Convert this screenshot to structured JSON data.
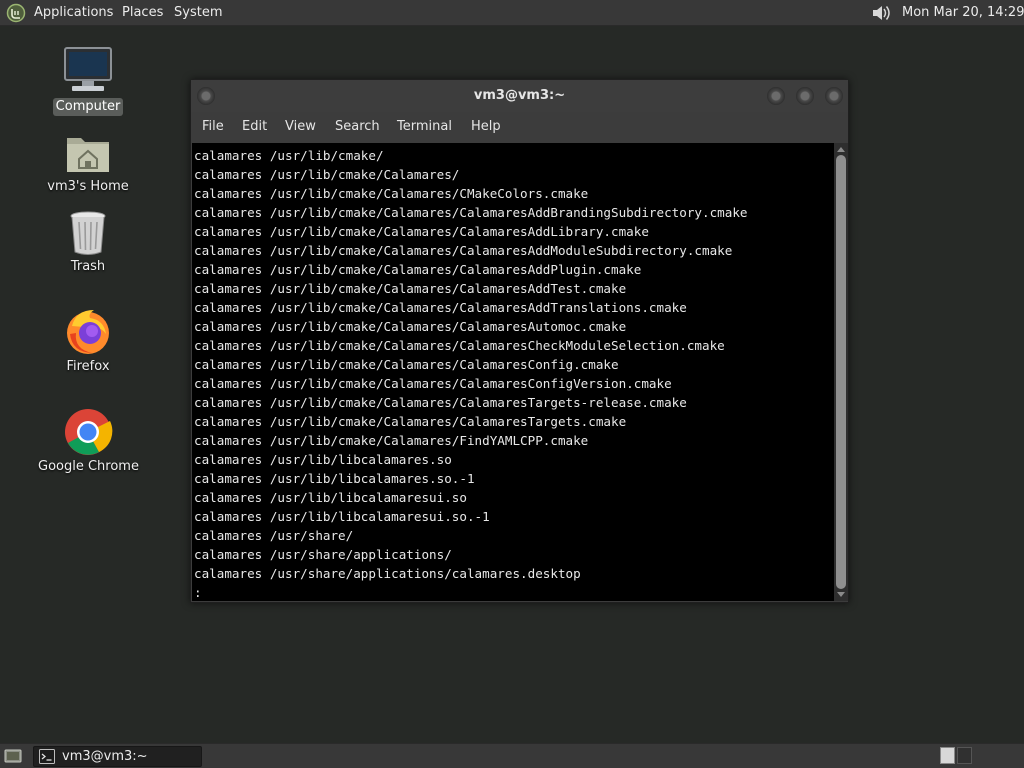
{
  "top_panel": {
    "menus": [
      "Applications",
      "Places",
      "System"
    ],
    "clock": "Mon Mar 20, 14:29",
    "icons": {
      "menu": "mint-menu-icon",
      "volume": "volume-icon"
    }
  },
  "desktop": {
    "icons": [
      {
        "label": "Computer",
        "icon": "computer-icon",
        "selected": true
      },
      {
        "label": "vm3's Home",
        "icon": "home-folder-icon",
        "selected": false
      },
      {
        "label": "Trash",
        "icon": "trash-icon",
        "selected": false
      },
      {
        "label": "Firefox",
        "icon": "firefox-icon",
        "selected": false
      },
      {
        "label": "Google Chrome",
        "icon": "chrome-icon",
        "selected": false
      }
    ]
  },
  "terminal": {
    "title": "vm3@vm3:~",
    "menu": [
      "File",
      "Edit",
      "View",
      "Search",
      "Terminal",
      "Help"
    ],
    "lines": [
      "calamares /usr/lib/cmake/",
      "calamares /usr/lib/cmake/Calamares/",
      "calamares /usr/lib/cmake/Calamares/CMakeColors.cmake",
      "calamares /usr/lib/cmake/Calamares/CalamaresAddBrandingSubdirectory.cmake",
      "calamares /usr/lib/cmake/Calamares/CalamaresAddLibrary.cmake",
      "calamares /usr/lib/cmake/Calamares/CalamaresAddModuleSubdirectory.cmake",
      "calamares /usr/lib/cmake/Calamares/CalamaresAddPlugin.cmake",
      "calamares /usr/lib/cmake/Calamares/CalamaresAddTest.cmake",
      "calamares /usr/lib/cmake/Calamares/CalamaresAddTranslations.cmake",
      "calamares /usr/lib/cmake/Calamares/CalamaresAutomoc.cmake",
      "calamares /usr/lib/cmake/Calamares/CalamaresCheckModuleSelection.cmake",
      "calamares /usr/lib/cmake/Calamares/CalamaresConfig.cmake",
      "calamares /usr/lib/cmake/Calamares/CalamaresConfigVersion.cmake",
      "calamares /usr/lib/cmake/Calamares/CalamaresTargets-release.cmake",
      "calamares /usr/lib/cmake/Calamares/CalamaresTargets.cmake",
      "calamares /usr/lib/cmake/Calamares/FindYAMLCPP.cmake",
      "calamares /usr/lib/libcalamares.so",
      "calamares /usr/lib/libcalamares.so.-1",
      "calamares /usr/lib/libcalamaresui.so",
      "calamares /usr/lib/libcalamaresui.so.-1",
      "calamares /usr/share/",
      "calamares /usr/share/applications/",
      "calamares /usr/share/applications/calamares.desktop",
      ":"
    ]
  },
  "bottom_panel": {
    "task": {
      "label": "vm3@vm3:~",
      "icon": "terminal-icon"
    },
    "show_desktop_icon": "show-desktop-icon",
    "workspace_icon": "workspace-switcher-icon"
  },
  "colors": {
    "desktop_bg": "#262926",
    "panel_bg": "#383838",
    "terminal_bg": "#000000",
    "terminal_fg": "#e8e8e8"
  }
}
